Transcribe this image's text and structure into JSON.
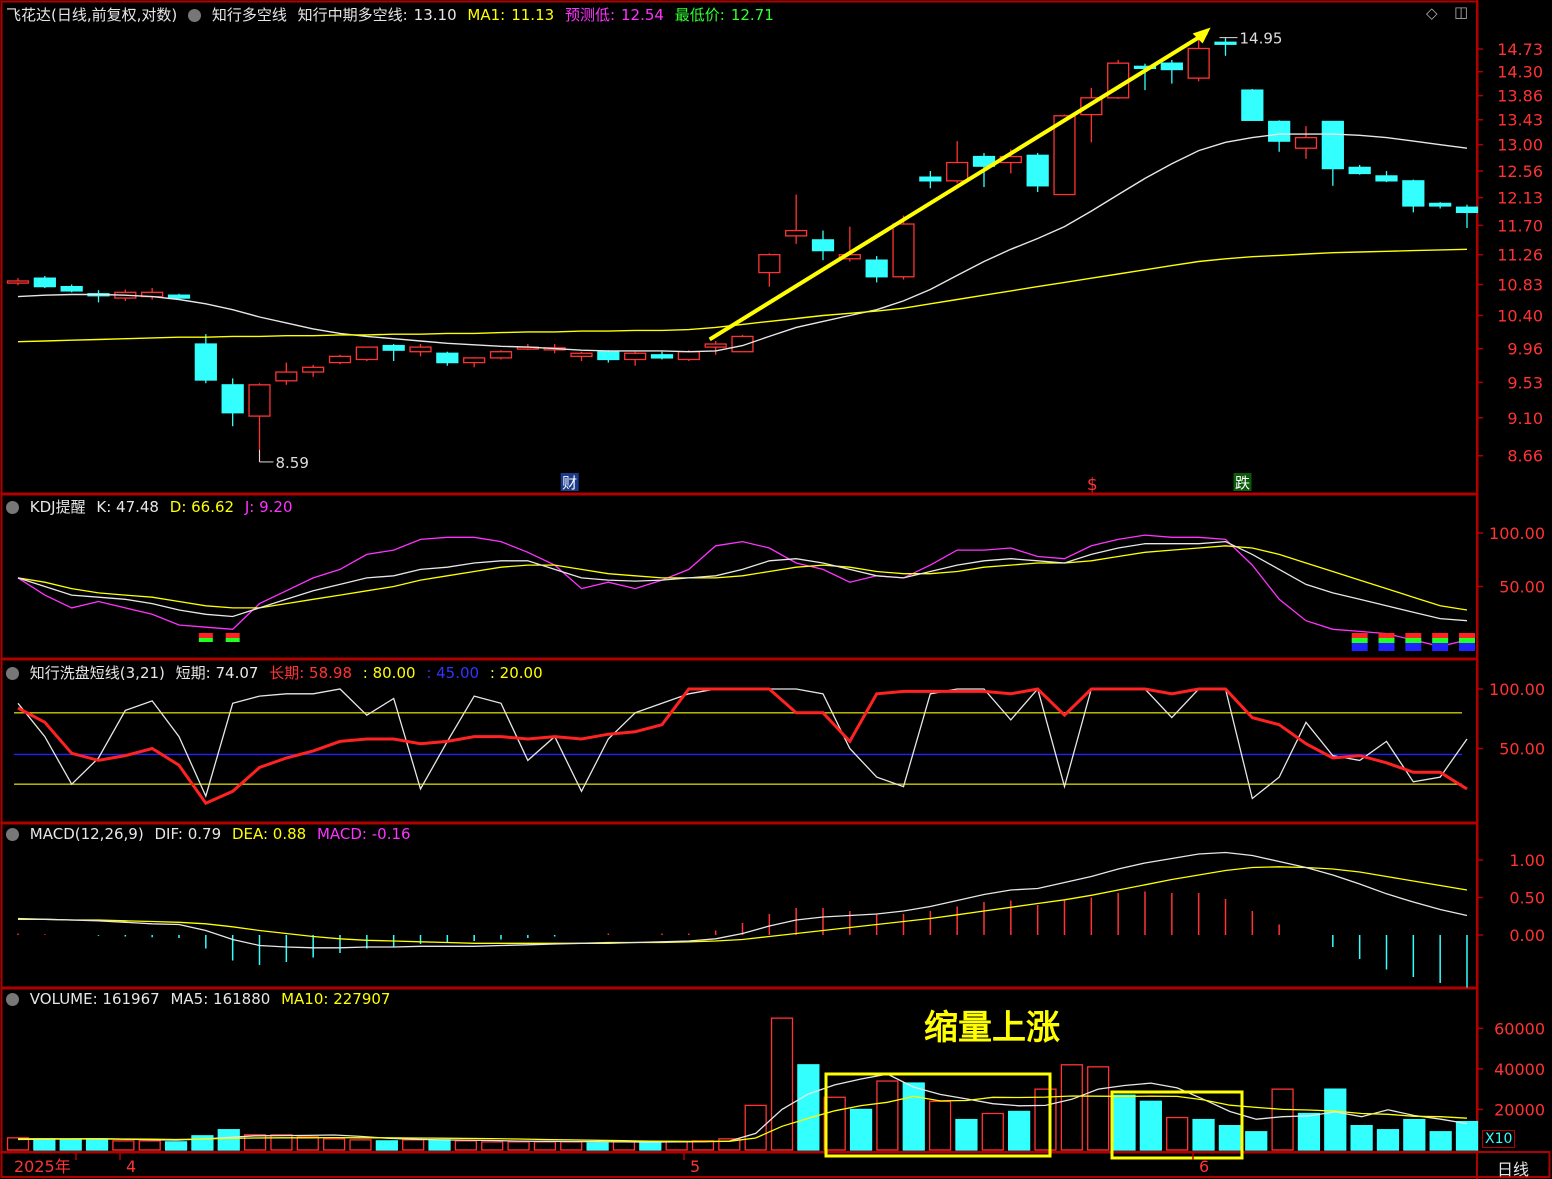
{
  "header": {
    "stock": "飞花达(日线,前复权,对数)",
    "indicator": "知行多空线",
    "mid_label": "知行中期多空线:",
    "mid_value": "13.10",
    "ma1_label": "MA1:",
    "ma1_value": "11.13",
    "pred_label": "预测低:",
    "pred_value": "12.54",
    "low_label": "最低价:",
    "low_value": "12.71"
  },
  "price_markers": {
    "high": "14.95",
    "low": "8.59",
    "events": [
      "财",
      "$",
      "跌"
    ]
  },
  "kdj": {
    "title": "KDJ提醒",
    "k": "K: 47.48",
    "d": "D: 66.62",
    "j": "J: 9.20"
  },
  "wash": {
    "title": "知行洗盘短线(3,21)",
    "short": "短期: 74.07",
    "long": "长期: 58.98",
    "l80": ": 80.00",
    "l45": ": 45.00",
    "l20": ": 20.00"
  },
  "macd": {
    "title": "MACD(12,26,9)",
    "dif": "DIF: 0.79",
    "dea": "DEA: 0.88",
    "macd": "MACD: -0.16"
  },
  "volume": {
    "title": "VOLUME: 161967",
    "ma5": "MA5: 161880",
    "ma10": "MA10: 227907",
    "annotation": "缩量上涨",
    "unit": "X10"
  },
  "xaxis": {
    "labels": [
      "2025年",
      "4",
      "5",
      "6"
    ],
    "period": "日线"
  },
  "colors": {
    "up": "#ff3333",
    "down": "#33ffff",
    "ma_white": "#e6e6e6",
    "ma_yellow": "#ffff00",
    "frame": "#b00000"
  },
  "chart_data": [
    {
      "type": "candlestick",
      "scale": "log",
      "yticks": [
        14.73,
        14.3,
        13.86,
        13.43,
        13.0,
        12.56,
        12.13,
        11.7,
        11.26,
        10.83,
        10.4,
        9.96,
        9.53,
        9.1,
        8.66
      ],
      "ylim": [
        8.5,
        15.1
      ],
      "ohlc": [
        [
          10.85,
          10.92,
          10.82,
          10.88
        ],
        [
          10.92,
          10.95,
          10.78,
          10.8
        ],
        [
          10.8,
          10.83,
          10.72,
          10.74
        ],
        [
          10.7,
          10.75,
          10.58,
          10.68
        ],
        [
          10.64,
          10.76,
          10.6,
          10.72
        ],
        [
          10.66,
          10.78,
          10.62,
          10.72
        ],
        [
          10.68,
          10.7,
          10.62,
          10.64
        ],
        [
          10.02,
          10.15,
          9.52,
          9.56
        ],
        [
          9.5,
          9.58,
          9.0,
          9.16
        ],
        [
          9.12,
          9.52,
          8.59,
          9.5
        ],
        [
          9.55,
          9.78,
          9.5,
          9.66
        ],
        [
          9.66,
          9.75,
          9.6,
          9.72
        ],
        [
          9.78,
          9.88,
          9.76,
          9.86
        ],
        [
          9.82,
          9.98,
          9.8,
          9.98
        ],
        [
          10.0,
          10.02,
          9.8,
          9.94
        ],
        [
          9.92,
          10.02,
          9.86,
          9.98
        ],
        [
          9.9,
          9.92,
          9.74,
          9.78
        ],
        [
          9.78,
          9.85,
          9.72,
          9.84
        ],
        [
          9.84,
          9.94,
          9.82,
          9.92
        ],
        [
          9.97,
          10.02,
          9.94,
          9.98
        ],
        [
          9.96,
          10.02,
          9.9,
          9.97
        ],
        [
          9.86,
          9.92,
          9.8,
          9.9
        ],
        [
          9.92,
          9.94,
          9.78,
          9.82
        ],
        [
          9.82,
          9.92,
          9.74,
          9.9
        ],
        [
          9.88,
          9.92,
          9.82,
          9.84
        ],
        [
          9.82,
          9.94,
          9.8,
          9.92
        ],
        [
          9.98,
          10.06,
          9.88,
          10.02
        ],
        [
          9.92,
          10.14,
          9.92,
          10.12
        ],
        [
          11.0,
          11.28,
          10.8,
          11.26
        ],
        [
          11.54,
          12.18,
          11.42,
          11.62
        ],
        [
          11.48,
          11.62,
          11.18,
          11.32
        ],
        [
          11.2,
          11.68,
          11.16,
          11.26
        ],
        [
          11.18,
          11.24,
          10.86,
          10.94
        ],
        [
          10.94,
          11.85,
          10.9,
          11.72
        ],
        [
          12.46,
          12.56,
          12.28,
          12.4
        ],
        [
          12.4,
          13.06,
          12.36,
          12.7
        ],
        [
          12.8,
          12.86,
          12.3,
          12.64
        ],
        [
          12.7,
          12.92,
          12.52,
          12.8
        ],
        [
          12.82,
          12.86,
          12.22,
          12.32
        ],
        [
          12.18,
          13.52,
          12.18,
          13.5
        ],
        [
          13.52,
          14.0,
          13.04,
          13.82
        ],
        [
          13.82,
          14.52,
          13.8,
          14.46
        ],
        [
          14.4,
          14.45,
          13.96,
          14.38
        ],
        [
          14.46,
          14.52,
          14.08,
          14.34
        ],
        [
          14.18,
          14.95,
          14.12,
          14.74
        ],
        [
          14.86,
          14.95,
          14.6,
          14.84
        ],
        [
          13.96,
          13.98,
          13.44,
          13.42
        ],
        [
          13.4,
          13.42,
          12.88,
          13.06
        ],
        [
          12.94,
          13.32,
          12.76,
          13.12
        ],
        [
          13.4,
          13.4,
          12.32,
          12.6
        ],
        [
          12.62,
          12.66,
          12.5,
          12.52
        ],
        [
          12.48,
          12.56,
          12.38,
          12.4
        ],
        [
          12.4,
          12.42,
          11.9,
          12.0
        ],
        [
          12.04,
          12.06,
          11.96,
          12.0
        ],
        [
          11.98,
          12.02,
          11.66,
          11.9
        ]
      ],
      "ma_white": [
        10.66,
        10.68,
        10.69,
        10.69,
        10.68,
        10.66,
        10.62,
        10.56,
        10.48,
        10.38,
        10.3,
        10.22,
        10.16,
        10.12,
        10.09,
        10.06,
        10.03,
        10.01,
        9.99,
        9.98,
        9.96,
        9.94,
        9.93,
        9.93,
        9.93,
        9.92,
        9.93,
        10.0,
        10.12,
        10.24,
        10.32,
        10.4,
        10.48,
        10.6,
        10.76,
        10.96,
        11.16,
        11.34,
        11.5,
        11.68,
        11.92,
        12.18,
        12.44,
        12.68,
        12.9,
        13.04,
        13.12,
        13.18,
        13.18,
        13.18,
        13.16,
        13.12,
        13.06,
        13.0,
        12.94
      ],
      "ma_yellow": [
        10.05,
        10.06,
        10.07,
        10.08,
        10.09,
        10.1,
        10.11,
        10.11,
        10.12,
        10.12,
        10.13,
        10.13,
        10.14,
        10.14,
        10.15,
        10.15,
        10.16,
        10.16,
        10.17,
        10.18,
        10.18,
        10.19,
        10.19,
        10.2,
        10.2,
        10.21,
        10.24,
        10.28,
        10.32,
        10.36,
        10.4,
        10.43,
        10.46,
        10.5,
        10.56,
        10.62,
        10.68,
        10.74,
        10.8,
        10.86,
        10.92,
        10.98,
        11.04,
        11.1,
        11.16,
        11.2,
        11.23,
        11.25,
        11.27,
        11.29,
        11.3,
        11.31,
        11.32,
        11.33,
        11.34
      ]
    },
    {
      "type": "line",
      "name": "KDJ",
      "ylim": [
        0,
        120
      ],
      "yticks": [
        100.0,
        50.0
      ],
      "k": [
        58,
        50,
        42,
        40,
        38,
        34,
        28,
        24,
        22,
        30,
        38,
        46,
        52,
        58,
        60,
        66,
        68,
        72,
        74,
        74,
        66,
        58,
        56,
        55,
        56,
        58,
        60,
        66,
        74,
        76,
        72,
        66,
        60,
        58,
        64,
        70,
        74,
        76,
        74,
        72,
        80,
        86,
        90,
        90,
        90,
        92,
        80,
        66,
        52,
        44,
        38,
        32,
        26,
        20,
        18
      ],
      "d": [
        58,
        54,
        48,
        44,
        42,
        40,
        36,
        32,
        30,
        30,
        34,
        38,
        42,
        46,
        50,
        56,
        60,
        64,
        68,
        70,
        70,
        66,
        62,
        60,
        58,
        58,
        58,
        60,
        64,
        68,
        70,
        68,
        64,
        62,
        62,
        64,
        68,
        70,
        72,
        72,
        74,
        78,
        82,
        84,
        86,
        88,
        86,
        80,
        72,
        64,
        56,
        48,
        40,
        32,
        28
      ],
      "j": [
        58,
        42,
        30,
        36,
        30,
        24,
        14,
        12,
        10,
        34,
        46,
        58,
        66,
        80,
        84,
        94,
        96,
        96,
        92,
        82,
        70,
        48,
        54,
        48,
        56,
        66,
        88,
        92,
        86,
        72,
        66,
        54,
        60,
        58,
        70,
        84,
        84,
        86,
        78,
        76,
        88,
        94,
        98,
        96,
        96,
        94,
        70,
        38,
        18,
        10,
        8,
        6,
        0,
        -6,
        0
      ]
    },
    {
      "type": "line",
      "name": "知行洗盘短线",
      "ylim": [
        0,
        110
      ],
      "yticks": [
        100.0,
        50.0
      ],
      "levels": [
        80,
        45,
        20
      ],
      "short": [
        88,
        60,
        20,
        42,
        82,
        90,
        60,
        10,
        88,
        94,
        96,
        96,
        100,
        78,
        92,
        16,
        56,
        94,
        88,
        40,
        60,
        14,
        58,
        80,
        88,
        96,
        100,
        100,
        100,
        100,
        96,
        50,
        26,
        18,
        96,
        100,
        100,
        74,
        100,
        18,
        100,
        100,
        100,
        76,
        100,
        100,
        8,
        26,
        72,
        44,
        40,
        56,
        22,
        26,
        58
      ],
      "long": [
        84,
        72,
        46,
        40,
        44,
        50,
        36,
        4,
        14,
        34,
        42,
        48,
        56,
        58,
        58,
        54,
        56,
        60,
        60,
        58,
        60,
        58,
        62,
        64,
        70,
        100,
        100,
        100,
        100,
        80,
        80,
        56,
        96,
        98,
        98,
        98,
        98,
        96,
        100,
        78,
        100,
        100,
        100,
        96,
        100,
        100,
        76,
        70,
        54,
        42,
        44,
        38,
        30,
        30,
        16
      ]
    },
    {
      "type": "bar+line",
      "name": "MACD",
      "ylim": [
        -1.3,
        1.3
      ],
      "yticks": [
        1.0,
        0.5,
        0.0
      ],
      "dif": [
        0.22,
        0.21,
        0.2,
        0.19,
        0.17,
        0.15,
        0.14,
        0.06,
        -0.06,
        -0.14,
        -0.16,
        -0.17,
        -0.17,
        -0.16,
        -0.16,
        -0.15,
        -0.15,
        -0.15,
        -0.14,
        -0.13,
        -0.12,
        -0.11,
        -0.1,
        -0.1,
        -0.09,
        -0.08,
        -0.05,
        0.02,
        0.12,
        0.2,
        0.24,
        0.26,
        0.28,
        0.32,
        0.38,
        0.46,
        0.54,
        0.6,
        0.62,
        0.7,
        0.78,
        0.88,
        0.96,
        1.02,
        1.08,
        1.1,
        1.06,
        0.98,
        0.9,
        0.8,
        0.68,
        0.55,
        0.44,
        0.34,
        0.26
      ],
      "dea": [
        0.21,
        0.21,
        0.2,
        0.2,
        0.19,
        0.18,
        0.17,
        0.15,
        0.11,
        0.06,
        0.02,
        -0.02,
        -0.05,
        -0.07,
        -0.08,
        -0.09,
        -0.1,
        -0.11,
        -0.11,
        -0.11,
        -0.11,
        -0.11,
        -0.11,
        -0.1,
        -0.1,
        -0.09,
        -0.08,
        -0.06,
        -0.02,
        0.02,
        0.06,
        0.1,
        0.14,
        0.18,
        0.22,
        0.27,
        0.32,
        0.37,
        0.42,
        0.47,
        0.53,
        0.6,
        0.67,
        0.74,
        0.8,
        0.86,
        0.9,
        0.91,
        0.9,
        0.88,
        0.84,
        0.78,
        0.72,
        0.66,
        0.6
      ],
      "macd": [
        0.02,
        0.01,
        0.0,
        -0.01,
        -0.02,
        -0.03,
        -0.04,
        -0.18,
        -0.34,
        -0.4,
        -0.36,
        -0.3,
        -0.24,
        -0.18,
        -0.16,
        -0.12,
        -0.1,
        -0.08,
        -0.06,
        -0.04,
        -0.02,
        0.0,
        0.02,
        0.0,
        0.02,
        0.02,
        0.06,
        0.16,
        0.28,
        0.36,
        0.36,
        0.32,
        0.28,
        0.28,
        0.32,
        0.38,
        0.44,
        0.46,
        0.4,
        0.46,
        0.5,
        0.56,
        0.58,
        0.56,
        0.56,
        0.48,
        0.32,
        0.14,
        0.0,
        -0.16,
        -0.32,
        -0.46,
        -0.56,
        -0.64,
        -0.7
      ]
    },
    {
      "type": "bar+line",
      "name": "VOLUME",
      "ylim": [
        0,
        70000
      ],
      "yticks": [
        60000,
        40000,
        20000
      ],
      "values": [
        6000,
        5500,
        5000,
        5500,
        4500,
        4500,
        4000,
        7000,
        10000,
        7500,
        7500,
        6500,
        5500,
        5000,
        4500,
        5000,
        5000,
        4500,
        4000,
        4000,
        4000,
        4000,
        3500,
        4000,
        4000,
        4000,
        4500,
        5500,
        22000,
        65000,
        42000,
        26000,
        20000,
        34000,
        33000,
        24000,
        15000,
        18000,
        19000,
        30000,
        42000,
        41000,
        27000,
        24000,
        16000,
        15000,
        12000,
        9000,
        30000,
        18000,
        30000,
        12000,
        10000,
        15000,
        9000,
        14000
      ],
      "ma5": [
        5200,
        5300,
        5400,
        5500,
        5300,
        5100,
        4900,
        5400,
        6200,
        7000,
        7100,
        7200,
        7400,
        6700,
        5800,
        5300,
        5000,
        4900,
        4700,
        4400,
        4300,
        4200,
        4100,
        4000,
        3900,
        4000,
        4100,
        4400,
        8200,
        20000,
        27600,
        32100,
        35000,
        37400,
        31000,
        27400,
        25200,
        22800,
        21800,
        22000,
        25000,
        30000,
        31800,
        33000,
        30600,
        25000,
        19000,
        15200,
        16400,
        16800,
        18800,
        16400,
        19800,
        17000,
        15200,
        13000
      ],
      "ma10": [
        5500,
        5500,
        5500,
        5500,
        5400,
        5300,
        5200,
        5400,
        5700,
        5900,
        6000,
        6000,
        6100,
        6000,
        6000,
        5900,
        5800,
        5700,
        5600,
        5400,
        5200,
        5000,
        4800,
        4600,
        4400,
        4300,
        4200,
        4300,
        5900,
        11700,
        15700,
        19300,
        21900,
        23500,
        26400,
        24200,
        24400,
        26000,
        25900,
        26100,
        26600,
        26500,
        26400,
        26500,
        26400,
        24700,
        22100,
        21000,
        20000,
        19700,
        19200,
        18000,
        17600,
        16600,
        16400,
        15700
      ]
    }
  ]
}
